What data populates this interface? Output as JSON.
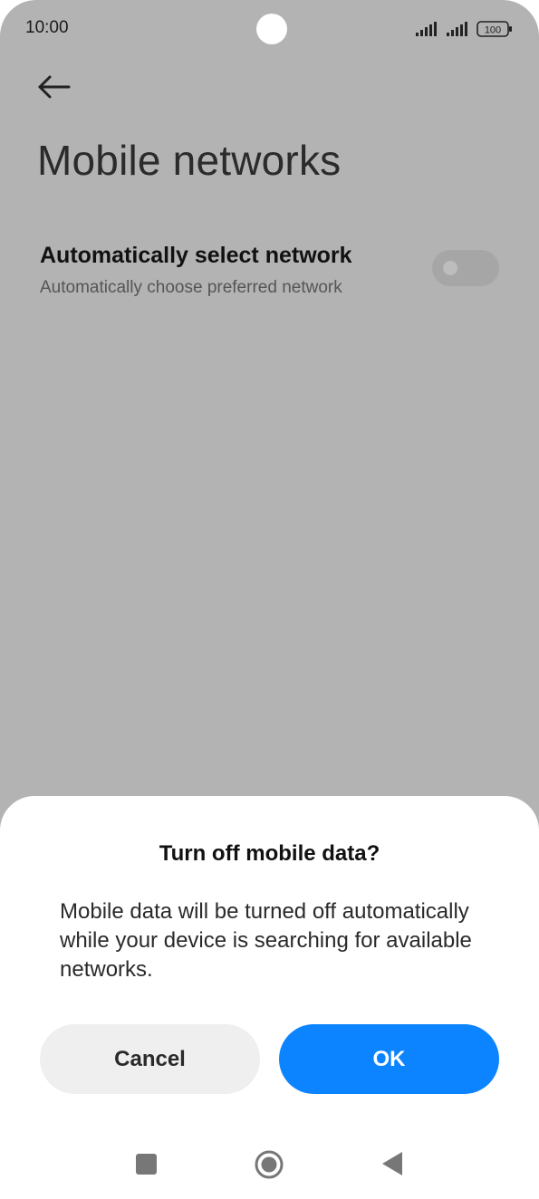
{
  "status_bar": {
    "time": "10:00",
    "battery_level": "100",
    "icons": [
      "signal-icon",
      "signal-icon",
      "battery-icon"
    ]
  },
  "header": {
    "back_icon": "arrow-left-icon",
    "title": "Mobile networks"
  },
  "settings": {
    "auto_select": {
      "title": "Automatically select network",
      "subtitle": "Automatically choose preferred network",
      "enabled": false
    }
  },
  "dialog": {
    "title": "Turn off mobile data?",
    "message": "Mobile data will be turned off automatically while your device is searching for available networks.",
    "cancel_label": "Cancel",
    "ok_label": "OK"
  },
  "nav_bar": {
    "icons": [
      "recents-icon",
      "home-icon",
      "back-icon"
    ]
  },
  "colors": {
    "scrim_background": "#b3b3b3",
    "accent": "#0d84ff",
    "cancel_button": "#efefef"
  }
}
